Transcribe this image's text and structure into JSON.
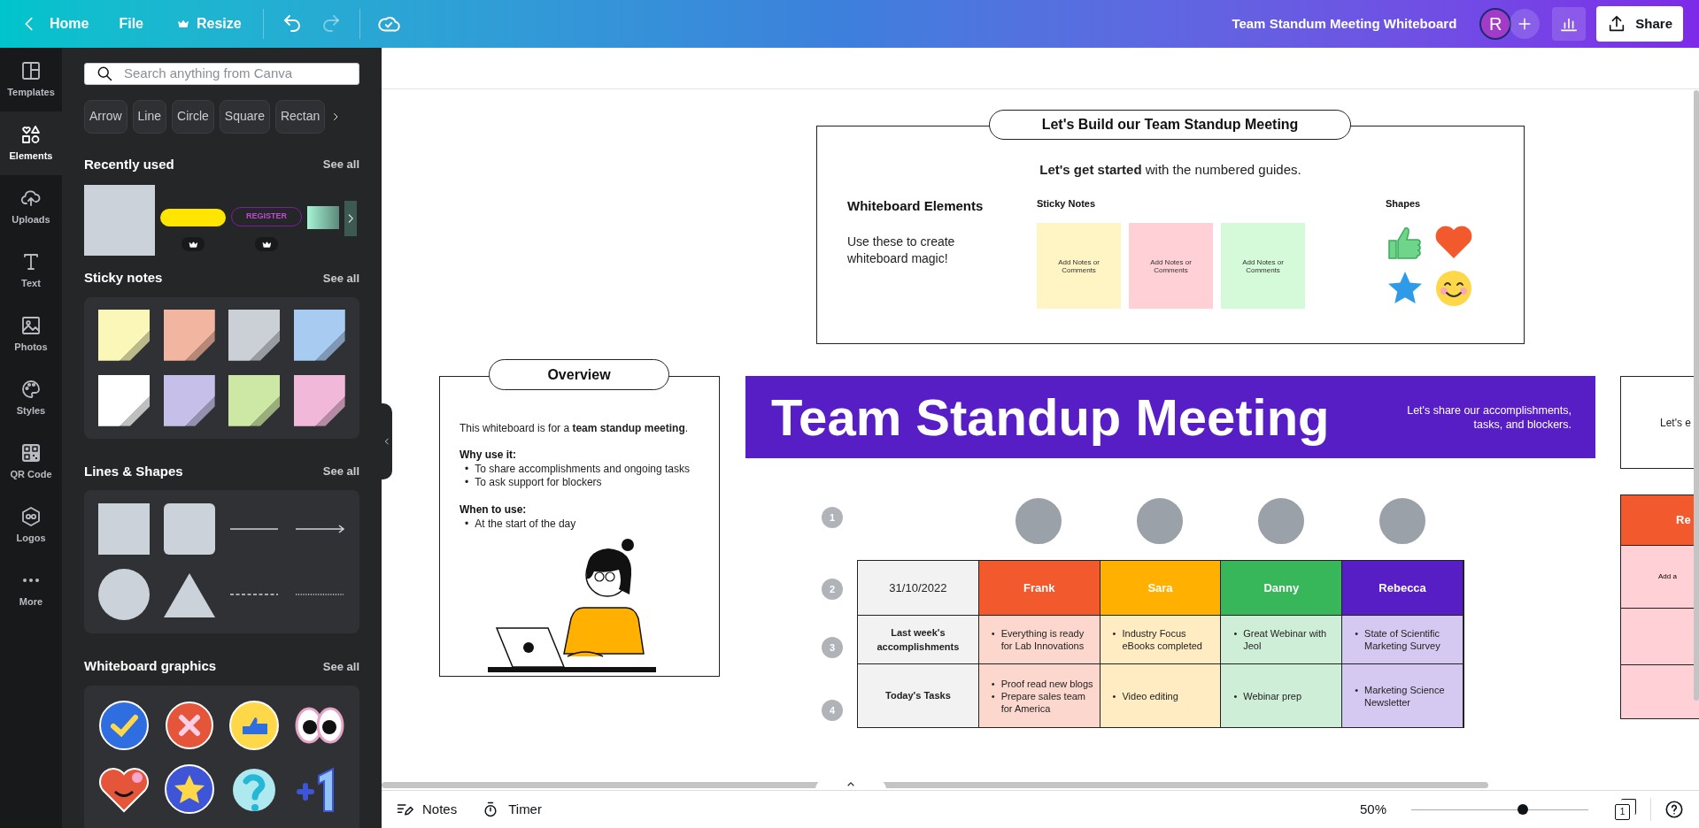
{
  "top_bar": {
    "back_label": "Home",
    "menu": [
      {
        "label": "File",
        "premium": false
      },
      {
        "label": "Resize",
        "premium": true
      }
    ],
    "document_title": "Team Standum Meeting Whiteboard",
    "avatar_letter": "R",
    "share_label": "Share"
  },
  "side_rail": [
    {
      "label": "Templates",
      "selected": false
    },
    {
      "label": "Elements",
      "selected": true
    },
    {
      "label": "Uploads",
      "selected": false
    },
    {
      "label": "Text",
      "selected": false
    },
    {
      "label": "Photos",
      "selected": false
    },
    {
      "label": "Styles",
      "selected": false
    },
    {
      "label": "QR Code",
      "selected": false
    },
    {
      "label": "Logos",
      "selected": false
    },
    {
      "label": "More",
      "selected": false
    }
  ],
  "panel": {
    "search_placeholder": "Search anything from Canva",
    "chips": [
      "Arrow",
      "Line",
      "Circle",
      "Square",
      "Rectan"
    ],
    "recently_used": {
      "title": "Recently used",
      "see_all": "See all",
      "items": [
        {
          "kind": "block",
          "premium": false
        },
        {
          "kind": "pill",
          "premium": true
        },
        {
          "kind": "register",
          "text": "REGISTER",
          "premium": true
        },
        {
          "kind": "gradient",
          "premium": false
        }
      ]
    },
    "sticky_notes": {
      "title": "Sticky notes",
      "see_all": "See all",
      "notes": [
        {
          "color": "#faf7b8"
        },
        {
          "color": "#f2b6a0"
        },
        {
          "color": "#cbd0d7"
        },
        {
          "color": "#a8cbf2"
        },
        {
          "color": "#ffffff"
        },
        {
          "color": "#c6bfea"
        },
        {
          "color": "#cde8a4"
        },
        {
          "color": "#f2b8d9"
        }
      ]
    },
    "lines_shapes": {
      "title": "Lines & Shapes",
      "see_all": "See all"
    },
    "whiteboard_graphics": {
      "title": "Whiteboard graphics",
      "see_all": "See all"
    }
  },
  "guide_card": {
    "label": "Let's Build our Team Standup Meeting",
    "intro": "**Let's get started** with the numbered guides.",
    "elements_title": "Whiteboard Elements",
    "elements_text": "Use these to create whiteboard magic!",
    "sticky_title": "Sticky Notes",
    "stickies": [
      {
        "text": "Add Notes or Comments",
        "color": "#fff4c4"
      },
      {
        "text": "Add Notes or Comments",
        "color": "#ffd0d5"
      },
      {
        "text": "Add Notes or Comments",
        "color": "#d4fad9"
      }
    ],
    "shapes_title": "Shapes"
  },
  "overview": {
    "label": "Overview",
    "bullet": "•",
    "intro": "This whiteboard is for a **team standup meeting**.",
    "why_title": "Why use it:",
    "why_items": [
      "To share accomplishments and ongoing tasks",
      "To ask support for blockers"
    ],
    "when_title": "When to use:",
    "when_items": [
      "At the start of the day"
    ]
  },
  "banner": {
    "title": "Team Standup Meeting",
    "subtitle": "Let's share our accomplishments, tasks, and blockers."
  },
  "steps": [
    "1",
    "2",
    "3",
    "4"
  ],
  "table": {
    "bullet": "•",
    "date": "31/10/2022",
    "people": [
      {
        "name": "Frank",
        "color": "#f25a2e"
      },
      {
        "name": "Sara",
        "color": "#ffb000"
      },
      {
        "name": "Danny",
        "color": "#38b75a"
      },
      {
        "name": "Rebecca",
        "color": "#561ec4"
      }
    ],
    "rows": [
      {
        "label": "Last week's accomplishments",
        "cells": [
          [
            "Everything is ready for Lab Innovations"
          ],
          [
            "Industry Focus eBooks completed"
          ],
          [
            "Great Webinar with Jeol"
          ],
          [
            "State of Scientific Marketing Survey"
          ]
        ]
      },
      {
        "label": "Today's Tasks",
        "cells": [
          [
            "Proof read new blogs",
            "Prepare sales team for America"
          ],
          [
            "Video editing"
          ],
          [
            "Webinar prep"
          ],
          [
            "Marketing Science Newsletter"
          ]
        ]
      }
    ]
  },
  "right_edge": {
    "card_text": "Let's e",
    "header": "Re",
    "cell_text": "Add a"
  },
  "bottom_bar": {
    "notes_label": "Notes",
    "timer_label": "Timer",
    "zoom": "50%",
    "zoom_level": {
      "level": 0.63
    },
    "page_count": "1"
  }
}
